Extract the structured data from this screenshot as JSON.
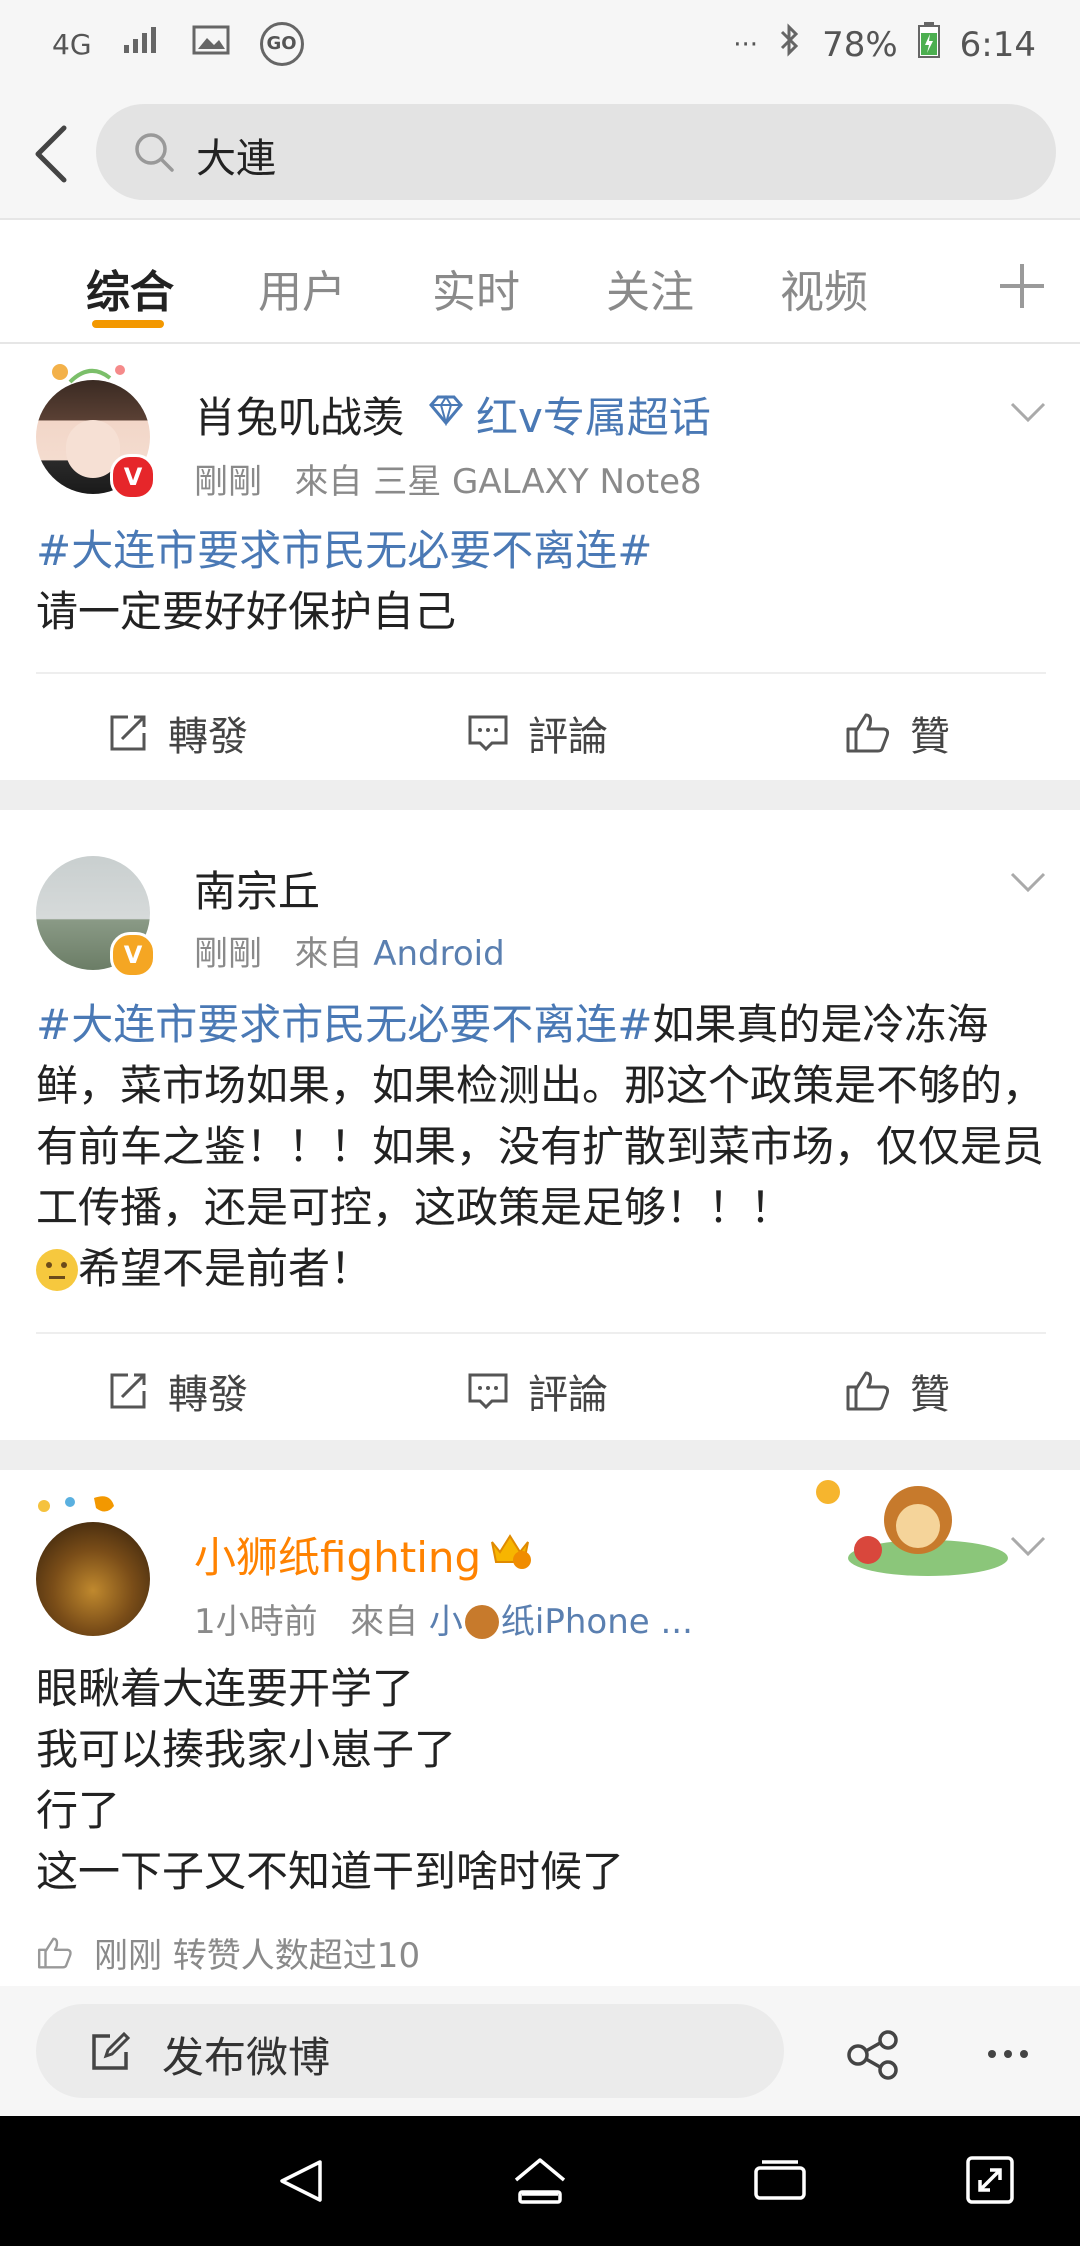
{
  "status_bar": {
    "network": "4G",
    "go_badge": "GO",
    "more": "···",
    "battery": "78%",
    "time": "6:14"
  },
  "search": {
    "query": "大連"
  },
  "tabs": [
    {
      "label": "综合",
      "active": true
    },
    {
      "label": "用户",
      "active": false
    },
    {
      "label": "实时",
      "active": false
    },
    {
      "label": "关注",
      "active": false
    },
    {
      "label": "视频",
      "active": false
    }
  ],
  "posts": [
    {
      "username": "肖兔叽战羡",
      "badge_text": "红v专属超话",
      "time": "剛剛",
      "source_prefix": "來自",
      "source": "三星 GALAXY Note8",
      "topic": "#大连市要求市民无必要不离连#",
      "text": "请一定要好好保护自己",
      "actions": {
        "repost": "轉發",
        "comment": "評論",
        "like": "贊"
      }
    },
    {
      "username": "南宗丘",
      "time": "剛剛",
      "source_prefix": "來自",
      "source": "Android",
      "topic": "#大连市要求市民无必要不离连#",
      "text": "如果真的是冷冻海鲜，菜市场如果，如果检测出。那这个政策是不够的，有前车之鉴！！！如果，没有扩散到菜市场，仅仅是员工传播，还是可控，这政策是足够！！！",
      "text_tail": "希望不是前者！",
      "actions": {
        "repost": "轉發",
        "comment": "評論",
        "like": "贊"
      }
    },
    {
      "username": "小狮纸fighting",
      "time": "1小時前",
      "source_prefix": "來自",
      "source_a": "小",
      "source_b": "纸iPhone ...",
      "lines": [
        "眼瞅着大连要开学了",
        "我可以揍我家小崽子了",
        "行了",
        "这一下子又不知道干到啥时候了"
      ],
      "footer": "刚刚 转赞人数超过10"
    }
  ],
  "compose": {
    "label": "发布微博"
  },
  "colors": {
    "accent": "#f39800",
    "link": "#4a79b5",
    "vip_orange": "#ff8200"
  }
}
